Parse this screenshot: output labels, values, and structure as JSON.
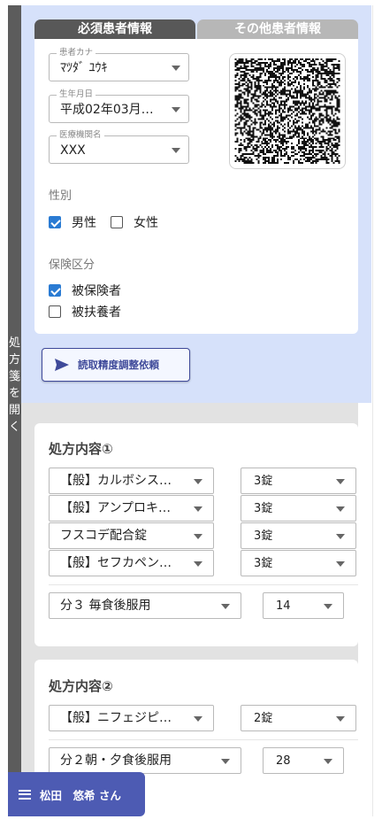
{
  "side_tab": {
    "label": "処方箋を開く"
  },
  "tabs": {
    "required": "必須患者情報",
    "other": "その他患者情報"
  },
  "patient": {
    "kana_label": "患者カナ",
    "kana_value": "ﾏﾂﾀﾞ ﾕｳｷ",
    "dob_label": "生年月日",
    "dob_value": "平成02年03月…",
    "facility_label": "医療機関名",
    "facility_value": "XXX",
    "sex_label": "性別",
    "sex_options": [
      {
        "label": "男性",
        "checked": true
      },
      {
        "label": "女性",
        "checked": false
      }
    ],
    "insurance_label": "保険区分",
    "insurance_options": [
      {
        "label": "被保険者",
        "checked": true
      },
      {
        "label": "被扶養者",
        "checked": false
      }
    ]
  },
  "qr_icon": "qr-code",
  "request_button": {
    "label": "読取精度調整依頼",
    "icon": "send-icon"
  },
  "prescriptions": [
    {
      "title": "処方内容①",
      "drugs": [
        {
          "name": "【般】カルボシス…",
          "qty": "3錠"
        },
        {
          "name": "【般】アンプロキ…",
          "qty": "3錠"
        },
        {
          "name": "フスコデ配合錠",
          "qty": "3錠"
        },
        {
          "name": "【般】セフカペン…",
          "qty": "3錠"
        }
      ],
      "usage": "分３ 毎食後服用",
      "days": "14"
    },
    {
      "title": "処方内容②",
      "drugs": [
        {
          "name": "【般】ニフェジピ…",
          "qty": "2錠"
        }
      ],
      "usage": "分２朝・夕食後服用",
      "days": "28"
    }
  ],
  "user": {
    "name": "松田　悠希 さん"
  },
  "colors": {
    "accent": "#4d5bb3",
    "panel_blue": "#d6e1fa",
    "check_blue": "#2a7bd3"
  }
}
